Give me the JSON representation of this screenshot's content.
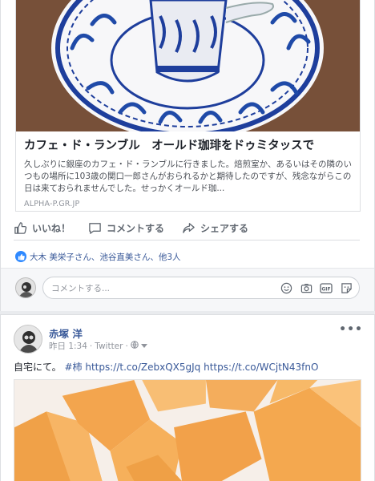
{
  "link_preview": {
    "title": "カフェ・ド・ランブル　オールド珈琲をドゥミタッスで",
    "description": "久しぶりに銀座のカフェ・ド・ランブルに行きました。焙煎室か、あるいはその隣のいつもの場所に103歳の関口一郎さんがおられるかと期待したのですが、残念ながらこの日は来ておられませんでした。せっかくオールド珈...",
    "domain": "ALPHA-P.GR.JP"
  },
  "actions": {
    "like": "いいね！",
    "comment": "コメントする",
    "share": "シェアする"
  },
  "reactions": {
    "text": "大木 美栄子さん、池谷直美さん、他3人"
  },
  "comment_box": {
    "placeholder": "コメントする..."
  },
  "post": {
    "author": "赤塚 洋",
    "time": "昨日 1:34",
    "source": "Twitter",
    "separator": "·",
    "text_plain": "自宅にて。",
    "hashtag": "#柿",
    "link1": "https://t.co/ZebxQX5gJq",
    "link2": "https://t.co/WCjtN43fnO"
  },
  "colors": {
    "link": "#385898",
    "like_blue": "#2e89ff",
    "persimmon": "#f2a24a"
  }
}
